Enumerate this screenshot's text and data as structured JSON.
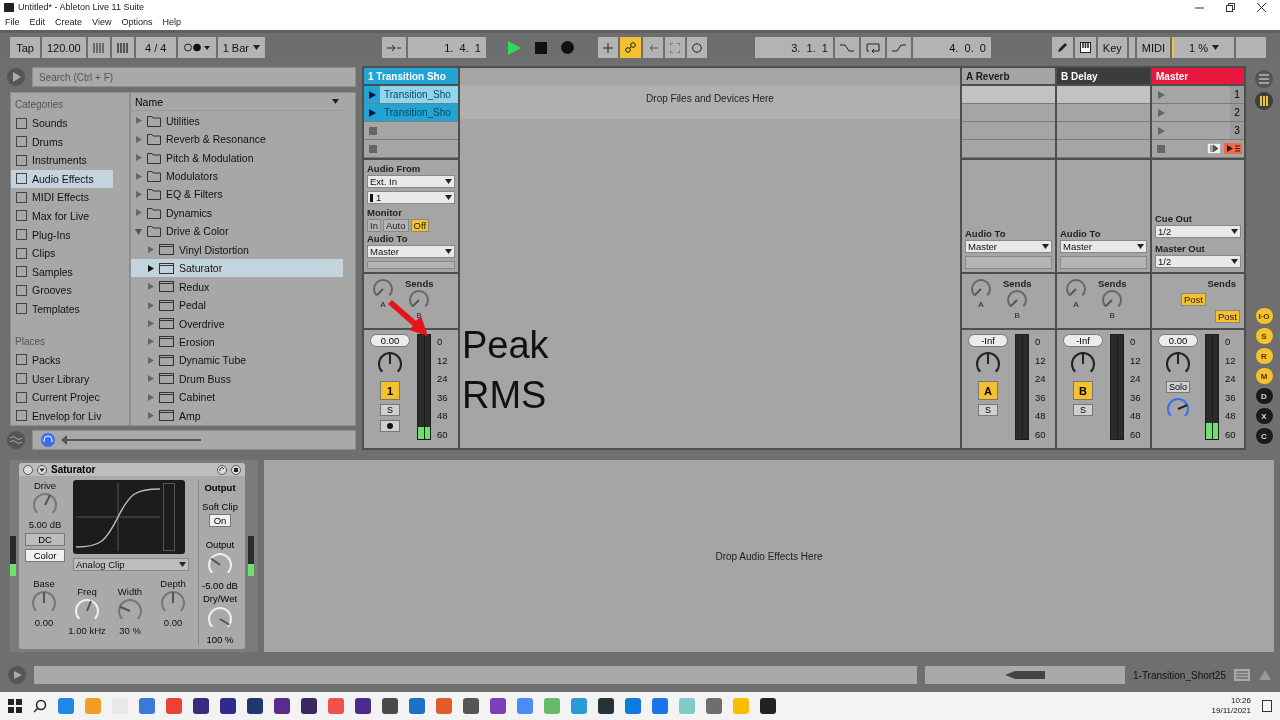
{
  "window": {
    "title": "Untitled* - Ableton Live 11 Suite"
  },
  "menu": [
    "File",
    "Edit",
    "Create",
    "View",
    "Options",
    "Help"
  ],
  "control_bar": {
    "tap": "Tap",
    "tempo": "120.00",
    "signature": "4 / 4",
    "quantization": "1 Bar",
    "position": "1.  4.  1",
    "automation_on": true,
    "loop_start": "3.  1.  1",
    "loop_length": "4.  0.  0",
    "key": "Key",
    "midi": "MIDI",
    "cpu": "1 %"
  },
  "browser": {
    "search": {
      "placeholder": "Search (Ctrl + F)"
    },
    "categories": {
      "title": "Categories",
      "items": [
        {
          "label": "Sounds",
          "selected": false
        },
        {
          "label": "Drums",
          "selected": false
        },
        {
          "label": "Instruments",
          "selected": false
        },
        {
          "label": "Audio Effects",
          "selected": true
        },
        {
          "label": "MIDI Effects",
          "selected": false
        },
        {
          "label": "Max for Live",
          "selected": false
        },
        {
          "label": "Plug-Ins",
          "selected": false
        },
        {
          "label": "Clips",
          "selected": false
        },
        {
          "label": "Samples",
          "selected": false
        },
        {
          "label": "Grooves",
          "selected": false
        },
        {
          "label": "Templates",
          "selected": false
        }
      ]
    },
    "places": {
      "title": "Places",
      "items": [
        {
          "label": "Packs",
          "selected": false
        },
        {
          "label": "User Library",
          "selected": false
        },
        {
          "label": "Current Projec",
          "selected": false
        },
        {
          "label": "Envelop for Liv",
          "selected": false
        }
      ]
    },
    "name_header": "Name",
    "items": [
      {
        "label": "Utilities",
        "expanded": false,
        "selected": false
      },
      {
        "label": "Reverb & Resonance",
        "expanded": false,
        "selected": false
      },
      {
        "label": "Pitch & Modulation",
        "expanded": false,
        "selected": false
      },
      {
        "label": "Modulators",
        "expanded": false,
        "selected": false
      },
      {
        "label": "EQ & Filters",
        "expanded": false,
        "selected": false
      },
      {
        "label": "Dynamics",
        "expanded": false,
        "selected": false
      },
      {
        "label": "Drive & Color",
        "expanded": true,
        "selected": false,
        "children": [
          {
            "label": "Vinyl Distortion",
            "expanded": false,
            "selected": false
          },
          {
            "label": "Saturator",
            "expanded": false,
            "selected": true
          },
          {
            "label": "Redux",
            "expanded": false,
            "selected": false
          },
          {
            "label": "Pedal",
            "expanded": false,
            "selected": false
          },
          {
            "label": "Overdrive",
            "expanded": false,
            "selected": false
          },
          {
            "label": "Erosion",
            "expanded": false,
            "selected": false
          },
          {
            "label": "Dynamic Tube",
            "expanded": false,
            "selected": false
          },
          {
            "label": "Drum Buss",
            "expanded": false,
            "selected": false
          },
          {
            "label": "Cabinet",
            "expanded": false,
            "selected": false
          },
          {
            "label": "Amp",
            "expanded": false,
            "selected": false
          }
        ]
      }
    ]
  },
  "session": {
    "drop_hint": "Drop Files and Devices Here",
    "annotations": [
      "Peak",
      "RMS"
    ],
    "tracks": [
      {
        "kind": "audio",
        "name": "1 Transition Sho",
        "color": "#22a4d4",
        "slots": [
          {
            "kind": "clip",
            "name": "Transition_Sho",
            "selected": true
          },
          {
            "kind": "clip",
            "name": "Transition_Sho",
            "selected": false
          },
          {
            "kind": "empty"
          },
          {
            "kind": "empty"
          }
        ],
        "audio_from": {
          "label": "Audio From",
          "source": "Ext. In",
          "channel": "1"
        },
        "monitor": {
          "label": "Monitor",
          "options": [
            {
              "label": "In",
              "selected": false
            },
            {
              "label": "Auto",
              "selected": false
            },
            {
              "label": "Off",
              "selected": true
            }
          ]
        },
        "audio_to": {
          "label": "Audio To",
          "value": "Master"
        },
        "sends": {
          "label": "Sends",
          "knobs": [
            "A",
            "B"
          ]
        },
        "volume": "0.00",
        "activator": {
          "label": "1",
          "on": true
        },
        "solo": {
          "label": "S",
          "on": false
        },
        "arm": {
          "on": false
        },
        "meter": {
          "level": 0.12
        },
        "scale": [
          "0",
          "12",
          "24",
          "36",
          "48",
          "60"
        ]
      },
      {
        "kind": "return",
        "name": "A Reverb",
        "color": "#a4a4a4",
        "slots": [
          {
            "kind": "blank"
          },
          {
            "kind": "blank"
          },
          {
            "kind": "blank"
          },
          {
            "kind": "blank"
          }
        ],
        "audio_to": {
          "label": "Audio To",
          "value": "Master"
        },
        "sends": {
          "label": "Sends",
          "knobs": [
            "A",
            "B"
          ]
        },
        "volume": "-Inf",
        "activator": {
          "label": "A",
          "on": true
        },
        "solo": {
          "label": "S",
          "on": false
        },
        "meter": {
          "level": 0
        },
        "scale": [
          "0",
          "12",
          "24",
          "36",
          "48",
          "60"
        ]
      },
      {
        "kind": "return",
        "name": "B Delay",
        "color": "#3c3c3c",
        "slots": [
          {
            "kind": "blank"
          },
          {
            "kind": "blank"
          },
          {
            "kind": "blank"
          },
          {
            "kind": "blank"
          }
        ],
        "audio_to": {
          "label": "Audio To",
          "value": "Master"
        },
        "sends": {
          "label": "Sends",
          "knobs": [
            "A",
            "B"
          ]
        },
        "volume": "-Inf",
        "activator": {
          "label": "B",
          "on": true
        },
        "solo": {
          "label": "S",
          "on": false
        },
        "meter": {
          "level": 0
        },
        "scale": [
          "0",
          "12",
          "24",
          "36",
          "48",
          "60"
        ]
      },
      {
        "kind": "master",
        "name": "Master",
        "color": "#e8173d",
        "slots": [
          {
            "kind": "scene",
            "label": "1"
          },
          {
            "kind": "scene",
            "label": "2"
          },
          {
            "kind": "scene",
            "label": "3"
          },
          {
            "kind": "stop_all"
          }
        ],
        "cue_out": {
          "label": "Cue Out",
          "value": "1/2"
        },
        "master_out": {
          "label": "Master Out",
          "value": "1/2"
        },
        "sends": {
          "label": "Sends",
          "posts": [
            "Post",
            "Post"
          ]
        },
        "volume": "0.00",
        "solo": {
          "label": "Solo",
          "on": false
        },
        "meter": {
          "level": 0.15
        },
        "scale": [
          "0",
          "12",
          "24",
          "36",
          "48",
          "60"
        ]
      }
    ]
  },
  "mode_buttons": [
    {
      "label": "I·O",
      "on": true
    },
    {
      "label": "S",
      "on": true
    },
    {
      "label": "R",
      "on": true
    },
    {
      "label": "M",
      "on": true
    },
    {
      "label": "D",
      "on": false
    },
    {
      "label": "X",
      "on": false
    },
    {
      "label": "C",
      "on": false
    }
  ],
  "device": {
    "name": "Saturator",
    "drive": {
      "label": "Drive",
      "value": "5.00 dB"
    },
    "dc": {
      "label": "DC",
      "on": false
    },
    "color": {
      "label": "Color",
      "on": true
    },
    "type": "Analog Clip",
    "output_title": "Output",
    "soft_clip": {
      "label": "Soft Clip",
      "button": "On",
      "on": true
    },
    "output": {
      "label": "Output",
      "value": "-5.00 dB"
    },
    "dry_wet": {
      "label": "Dry/Wet",
      "value": "100 %"
    },
    "knobs": [
      {
        "label": "Base",
        "value": "0.00"
      },
      {
        "label": "Freq",
        "value": "1.00 kHz"
      },
      {
        "label": "Width",
        "value": "30 %"
      },
      {
        "label": "Depth",
        "value": "0.00"
      }
    ],
    "drop_hint": "Drop Audio Effects Here"
  },
  "status_bar": {
    "clip_name": "1-Transition_Short25"
  },
  "taskbar": {
    "time": "10:26",
    "date": "19/11/2021"
  }
}
